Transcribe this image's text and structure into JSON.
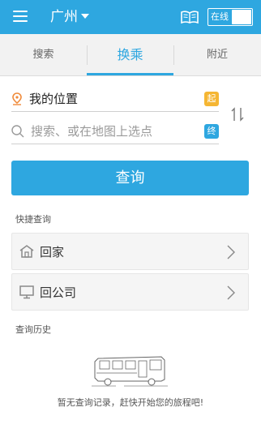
{
  "header": {
    "city": "广州",
    "online_label": "在线"
  },
  "tabs": [
    {
      "label": "搜索"
    },
    {
      "label": "换乘"
    },
    {
      "label": "附近"
    }
  ],
  "route": {
    "start_value": "我的位置",
    "start_badge": "起",
    "end_placeholder": "搜索、或在地图上选点",
    "end_badge": "终"
  },
  "query_button": "查询",
  "quick": {
    "title": "快捷查询",
    "items": [
      {
        "label": "回家",
        "icon": "home-icon"
      },
      {
        "label": "回公司",
        "icon": "computer-icon"
      }
    ]
  },
  "history": {
    "title": "查询历史",
    "empty_text": "暂无查询记录，赶快开始您的旅程吧!"
  },
  "colors": {
    "accent": "#2ea7e0",
    "start_badge": "#f5b633",
    "location_pin": "#f08a3a"
  }
}
